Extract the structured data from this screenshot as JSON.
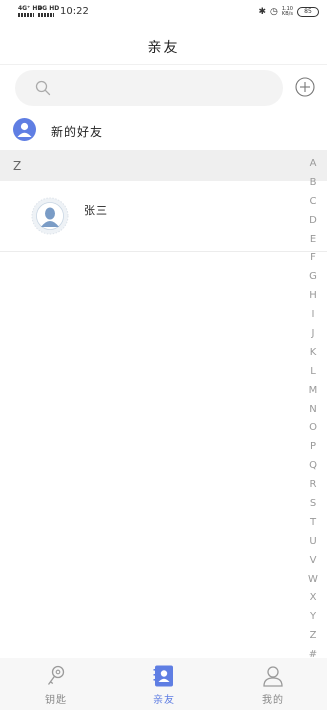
{
  "status_bar": {
    "sim1": "4G⁺ HD",
    "sim2": "4G HD",
    "time": "10:22",
    "speed_value": "1.10",
    "speed_unit": "KB/s",
    "battery": "85"
  },
  "header": {
    "title": "亲友"
  },
  "search": {
    "placeholder": ""
  },
  "new_friends": {
    "label": "新的好友"
  },
  "contacts": {
    "sections": [
      {
        "letter": "Z",
        "items": [
          {
            "name": "张三"
          }
        ]
      }
    ]
  },
  "alphabet": [
    "A",
    "B",
    "C",
    "D",
    "E",
    "F",
    "G",
    "H",
    "I",
    "J",
    "K",
    "L",
    "M",
    "N",
    "O",
    "P",
    "Q",
    "R",
    "S",
    "T",
    "U",
    "V",
    "W",
    "X",
    "Y",
    "Z",
    "#"
  ],
  "bottom_nav": {
    "items": [
      {
        "label": "钥匙",
        "icon": "key-icon",
        "active": false
      },
      {
        "label": "亲友",
        "icon": "contacts-icon",
        "active": true
      },
      {
        "label": "我的",
        "icon": "profile-icon",
        "active": false
      }
    ]
  },
  "colors": {
    "accent": "#5f7ee3",
    "section_bg": "#efefef",
    "nav_bg": "#f7f7f7",
    "search_bg": "#f3f3f3"
  }
}
